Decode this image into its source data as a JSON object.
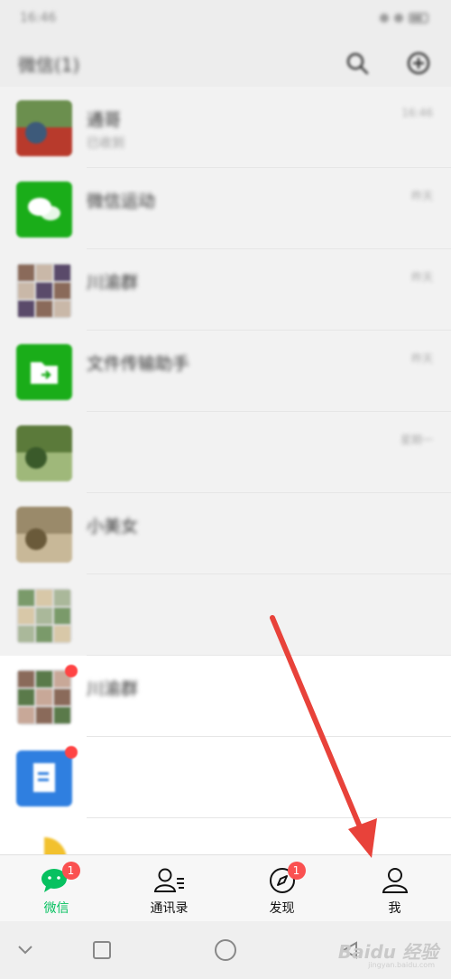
{
  "status_bar": {
    "time": "16:46",
    "right": ""
  },
  "header": {
    "title": "微信(1)"
  },
  "chats": [
    {
      "name": "通哥",
      "preview": "已收到",
      "time": "16:46",
      "avatar": "photo",
      "colors": [
        "#6b8f4e",
        "#b83a2c",
        "#3d5a7a"
      ],
      "bg": "dim"
    },
    {
      "name": "微信运动",
      "preview": "",
      "time": "昨天",
      "avatar": "wechat-sport",
      "colors": [
        "#1aad19"
      ],
      "bg": "dim"
    },
    {
      "name": "川渝群",
      "preview": "",
      "time": "昨天",
      "avatar": "grid",
      "colors": [
        "#8a6a5a",
        "#c9b8a8",
        "#5a4a6a"
      ],
      "bg": "dim"
    },
    {
      "name": "文件传输助手",
      "preview": "",
      "time": "昨天",
      "avatar": "file-transfer",
      "colors": [
        "#1aad19"
      ],
      "bg": "dim"
    },
    {
      "name": "",
      "preview": "",
      "time": "星期一",
      "avatar": "photo",
      "colors": [
        "#5b7a3a",
        "#9fb87a",
        "#3a5a2a"
      ],
      "bg": "dim"
    },
    {
      "name": "小美女",
      "preview": "",
      "time": "",
      "avatar": "photo",
      "colors": [
        "#9a8a6a",
        "#c8b898",
        "#6a5a3a"
      ],
      "bg": "dim"
    },
    {
      "name": "",
      "preview": "",
      "time": "",
      "avatar": "grid",
      "colors": [
        "#7a9a6a",
        "#d8c8a8",
        "#aab89a"
      ],
      "bg": "dim"
    },
    {
      "name": "川渝群",
      "preview": "",
      "time": "",
      "avatar": "grid",
      "colors": [
        "#8a6a5a",
        "#5a7a4a",
        "#c8a898"
      ],
      "bg": "bright",
      "badge": true
    },
    {
      "name": "",
      "preview": "",
      "time": "",
      "avatar": "doc-blue",
      "colors": [
        "#2f7fe0"
      ],
      "bg": "bright",
      "badge": true
    },
    {
      "name": "",
      "preview": "",
      "time": "",
      "avatar": "news",
      "colors": [
        "#f2c12e",
        "#2aa84a",
        "#2f7fe0"
      ],
      "bg": "bright"
    }
  ],
  "tabs": [
    {
      "label": "微信",
      "icon": "chat-bubbles-icon",
      "badge": "1",
      "active": true
    },
    {
      "label": "通讯录",
      "icon": "contacts-icon",
      "badge": "",
      "active": false
    },
    {
      "label": "发现",
      "icon": "compass-icon",
      "badge": "1",
      "active": false
    },
    {
      "label": "我",
      "icon": "person-icon",
      "badge": "",
      "active": false
    }
  ],
  "nav_bar": {
    "buttons": [
      "chevron-down-icon",
      "square-icon",
      "circle-icon",
      "back-triangle-icon"
    ]
  },
  "watermark": {
    "text": "Baidu 经验",
    "sub": "jingyan.baidu.com"
  },
  "colors": {
    "accent": "#07c160",
    "badge": "#fa5151",
    "arrow": "#e8423a"
  }
}
